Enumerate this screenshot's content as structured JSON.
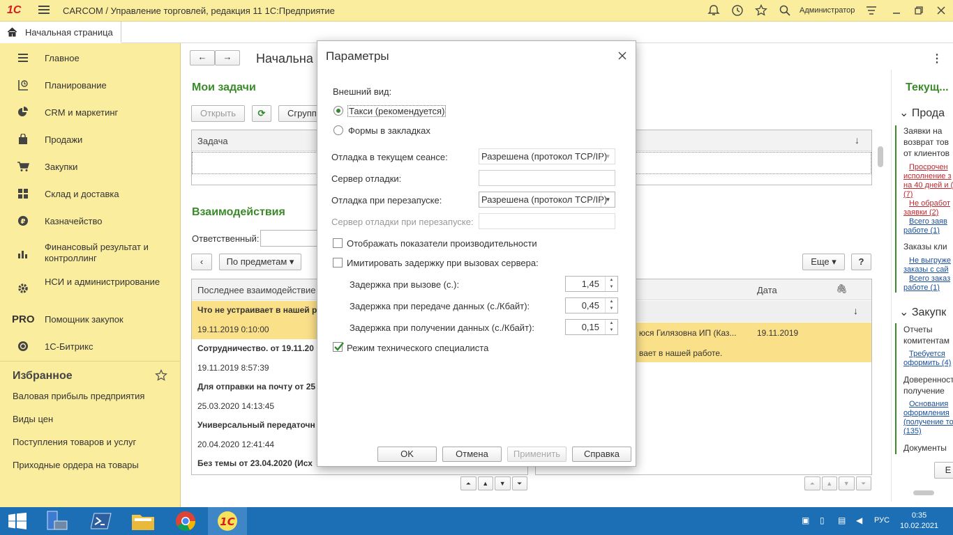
{
  "app": {
    "logo": "1С",
    "title": "CARCOM / Управление торговлей, редакция 11 1С:Предприятие",
    "user": "Администратор"
  },
  "tabs": {
    "home": "Начальная страница"
  },
  "sidebar": {
    "items": [
      {
        "label": "Главное",
        "icon": "menu-lines-icon"
      },
      {
        "label": "Планирование",
        "icon": "planning-icon"
      },
      {
        "label": "CRM и маркетинг",
        "icon": "pie-chart-icon"
      },
      {
        "label": "Продажи",
        "icon": "shopping-bag-icon"
      },
      {
        "label": "Закупки",
        "icon": "cart-icon"
      },
      {
        "label": "Склад и доставка",
        "icon": "warehouse-icon"
      },
      {
        "label": "Казначейство",
        "icon": "ruble-icon"
      },
      {
        "label": "Финансовый результат и контроллинг",
        "icon": "bar-chart-icon"
      },
      {
        "label": "НСИ и администрирование",
        "icon": "gear-icon"
      },
      {
        "label": "Помощник закупок",
        "icon": "pro-icon",
        "icon_text": "PRO"
      },
      {
        "label": "1С-Битрикс",
        "icon": "bitrix-icon"
      }
    ],
    "favorites_title": "Избранное",
    "favorites": [
      "Валовая прибыль предприятия",
      "Виды цен",
      "Поступления товаров и услуг",
      "Приходные ордера на товары"
    ]
  },
  "main": {
    "page_title": "Начальна",
    "tasks": {
      "title": "Мои задачи",
      "open_button": "Открыть",
      "group_button": "Сгрупп",
      "column_task": "Задача"
    },
    "interactions": {
      "title": "Взаимодействия",
      "responsible_label": "Ответственный:",
      "by_subject_button": "По предметам",
      "more_button": "Еще",
      "help_button": "?",
      "column_last": "Последнее взаимодействие",
      "column_date": "Дата",
      "list": [
        {
          "title": "Что не устраивает в нашей р",
          "date": "19.11.2019 0:10:00",
          "highlight": true
        },
        {
          "title": "Сотрудничество. от 19.11.20",
          "date": "19.11.2019 8:57:39",
          "highlight": false
        },
        {
          "title": "Для отправки на почту от 25",
          "date": "25.03.2020 14:13:45",
          "highlight": false
        },
        {
          "title": "Универсальный передаточн",
          "date": "20.04.2020 12:41:44",
          "highlight": false
        },
        {
          "title": "Без темы от 23.04.2020 (Исх",
          "date": "",
          "highlight": false
        }
      ],
      "detail_row": {
        "contact": "юся Гилязовна ИП (Каз...",
        "date": "19.11.2019",
        "text": "вает в нашей работе."
      }
    }
  },
  "dialog": {
    "title": "Параметры",
    "appearance_label": "Внешний вид:",
    "radio_taxi": "Такси (рекомендуется)",
    "radio_tabs": "Формы в закладках",
    "selected_radio": "taxi",
    "debug_current_label": "Отладка в текущем сеансе:",
    "debug_current_value": "Разрешена (протокол TCP/IP)",
    "debug_server_label": "Сервер отладки:",
    "debug_server_value": "",
    "debug_restart_label": "Отладка при перезапуске:",
    "debug_restart_value": "Разрешена (протокол TCP/IP)",
    "debug_restart_server_label": "Сервер отладки при перезапуске:",
    "debug_restart_server_value": "",
    "perf_label": "Отображать показатели производительности",
    "perf_checked": false,
    "delay_label": "Имитировать задержку при вызовах сервера:",
    "delay_checked": false,
    "delay_call_label": "Задержка при вызове (с.):",
    "delay_call_value": "1,45",
    "delay_send_label": "Задержка при передаче данных (с./Кбайт):",
    "delay_send_value": "0,45",
    "delay_recv_label": "Задержка при получении данных (с./Кбайт):",
    "delay_recv_value": "0,15",
    "tech_label": "Режим технического специалиста",
    "tech_checked": true,
    "ok_button": "OK",
    "cancel_button": "Отмена",
    "apply_button": "Применить",
    "help_button": "Справка"
  },
  "right_panel": {
    "title": "Текущ...",
    "sales_header": "Прода",
    "returns_text": [
      "Заявки на",
      "возврат тов",
      "от клиентов"
    ],
    "link_overdue": [
      "Просрочен",
      "исполнение з",
      "на 40 дней и (",
      "(7)"
    ],
    "link_unprocessed": [
      "Не обработ",
      "заявки (2)"
    ],
    "link_total_work": [
      "Всего заяв",
      "работе (1)"
    ],
    "client_orders": "Заказы кли",
    "link_not_unloaded": [
      "Не выгруже",
      "заказы с сай"
    ],
    "link_total_orders": [
      "Всего заказ",
      "работе (1)"
    ],
    "purchases_header": "Закупк",
    "commission": [
      "Отчеты",
      "комитентам"
    ],
    "link_required": [
      "Требуется",
      "оформить (4)"
    ],
    "powers": [
      "Доверенност",
      "получение"
    ],
    "link_reasons": [
      "Основания",
      "оформления",
      "(получение то",
      "(135)"
    ],
    "documents": "Документы",
    "button_e": "Е"
  },
  "taskbar": {
    "lang": "РУС",
    "time": "0:35",
    "date": "10.02.2021"
  },
  "colors": {
    "accent_green": "#3a8a2a",
    "sidebar_bg": "#fbed9e",
    "taskbar_bg": "#1c6fb5",
    "highlight_row": "#fbe08a",
    "link_red": "#c0272d",
    "link_blue": "#1a4f9c"
  }
}
